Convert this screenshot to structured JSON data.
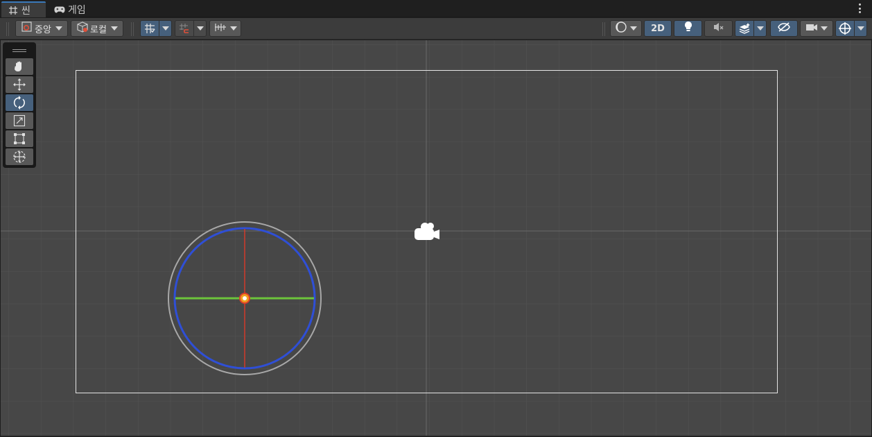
{
  "tabs": [
    {
      "label": "씬",
      "icon": "grid-icon",
      "active": true
    },
    {
      "label": "게임",
      "icon": "gamepad-icon",
      "active": false
    }
  ],
  "toolbar": {
    "pivot": {
      "label": "중앙",
      "icon": "pivot-center-icon"
    },
    "space": {
      "label": "로컬",
      "icon": "local-cube-icon"
    },
    "mode_2d": {
      "label": "2D"
    }
  },
  "tools": [
    {
      "name": "hand",
      "icon": "hand-icon",
      "active": false
    },
    {
      "name": "move",
      "icon": "move-icon",
      "active": false
    },
    {
      "name": "rotate",
      "icon": "rotate-icon",
      "active": true
    },
    {
      "name": "scale",
      "icon": "scale-icon",
      "active": false
    },
    {
      "name": "rect",
      "icon": "rect-tool-icon",
      "active": false
    },
    {
      "name": "transform",
      "icon": "transform-icon",
      "active": false
    }
  ],
  "colors": {
    "accent": "#46607c",
    "viewport_bg": "#474747",
    "gizmo_red": "#d23a2a",
    "gizmo_green": "#6cc43b",
    "gizmo_blue": "#2f4fd6",
    "gizmo_outer": "#a8a8a8"
  }
}
